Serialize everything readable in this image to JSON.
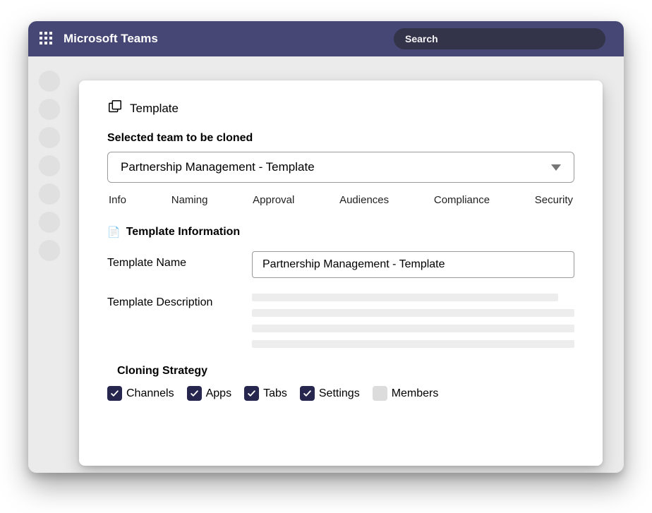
{
  "header": {
    "app_title": "Microsoft Teams",
    "search_placeholder": "Search"
  },
  "panel": {
    "title": "Template",
    "selected_team_label": "Selected team to be cloned",
    "selected_team_value": "Partnership Management - Template",
    "tabs": [
      "Info",
      "Naming",
      "Approval",
      "Audiences",
      "Compliance",
      "Security"
    ],
    "section_title": "Template Information",
    "template_name_label": "Template Name",
    "template_name_value": "Partnership Management - Template",
    "template_description_label": "Template Description",
    "cloning_strategy_title": "Cloning Strategy",
    "cloning_options": [
      {
        "label": "Channels",
        "checked": true
      },
      {
        "label": "Apps",
        "checked": true
      },
      {
        "label": "Tabs",
        "checked": true
      },
      {
        "label": "Settings",
        "checked": true
      },
      {
        "label": "Members",
        "checked": false
      }
    ]
  }
}
